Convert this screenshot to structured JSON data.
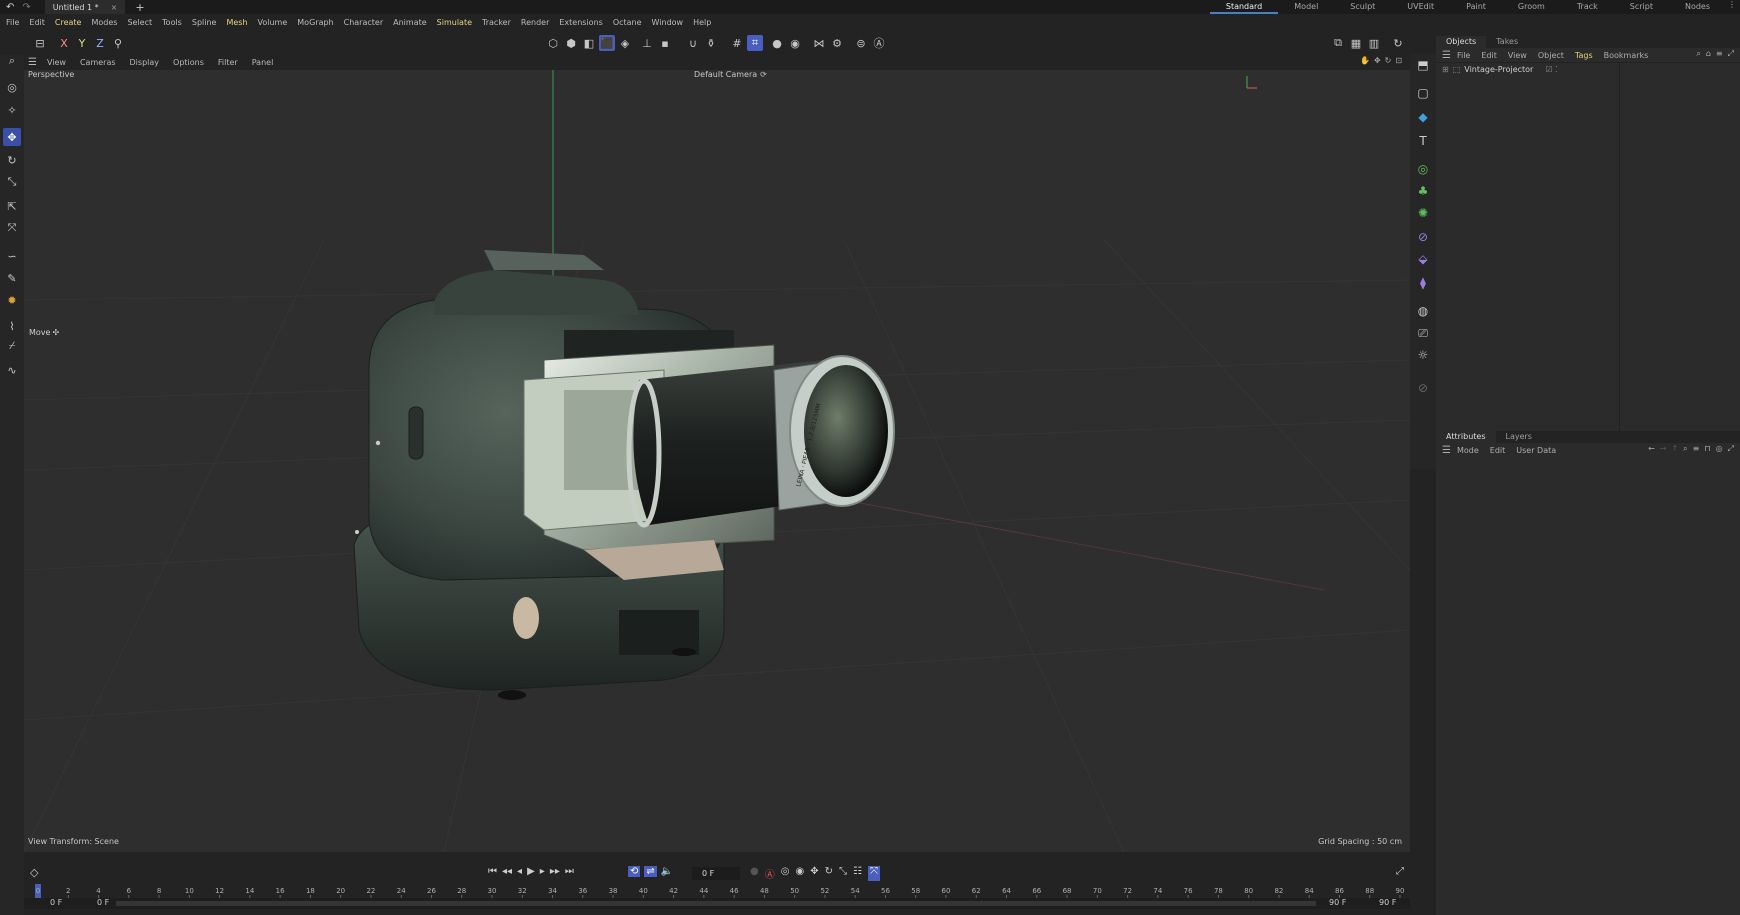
{
  "titlebar": {
    "tab_title": "Untitled 1 *",
    "close": "×",
    "add": "+",
    "workspaces": [
      "Standard",
      "Model",
      "Sculpt",
      "UVEdit",
      "Paint",
      "Groom",
      "Track",
      "Script",
      "Nodes"
    ],
    "active_workspace": "Standard"
  },
  "menubar": {
    "items": [
      "File",
      "Edit",
      "Create",
      "Modes",
      "Select",
      "Tools",
      "Spline",
      "Mesh",
      "Volume",
      "MoGraph",
      "Character",
      "Animate",
      "Simulate",
      "Tracker",
      "Render",
      "Extensions",
      "Octane",
      "Window",
      "Help"
    ],
    "highlighted": [
      "Create",
      "Mesh",
      "Simulate"
    ]
  },
  "toolbar": {
    "axis_x": "X",
    "axis_y": "Y",
    "axis_z": "Z"
  },
  "viewport_menu": {
    "items": [
      "View",
      "Cameras",
      "Display",
      "Options",
      "Filter",
      "Panel"
    ]
  },
  "viewport": {
    "view_name": "Perspective",
    "camera": "Default Camera",
    "camera_icon": "⟳",
    "tool_label": "Move",
    "tool_icon": "✣",
    "view_transform": "View Transform: Scene",
    "grid_spacing": "Grid Spacing : 50 cm",
    "lens_text": "LEINA · PIEAR · 1:2.8/125MM"
  },
  "objects_panel": {
    "tabs": [
      "Objects",
      "Takes"
    ],
    "menu": [
      "File",
      "Edit",
      "View",
      "Object",
      "Tags",
      "Bookmarks"
    ],
    "highlighted": "Tags",
    "objects": [
      {
        "name": "Vintage-Projector"
      }
    ]
  },
  "attributes_panel": {
    "tabs": [
      "Attributes",
      "Layers"
    ],
    "menu": [
      "Mode",
      "Edit",
      "User Data"
    ]
  },
  "timeline": {
    "current_frame": "0 F",
    "start_frame": "0 F",
    "min_frame": "0 F",
    "end_frame": "90 F",
    "max_frame": "90 F",
    "ticks": [
      "0",
      "2",
      "4",
      "6",
      "8",
      "10",
      "12",
      "14",
      "16",
      "18",
      "20",
      "22",
      "24",
      "26",
      "28",
      "30",
      "32",
      "34",
      "36",
      "38",
      "40",
      "42",
      "44",
      "46",
      "48",
      "50",
      "52",
      "54",
      "56",
      "58",
      "60",
      "62",
      "64",
      "66",
      "68",
      "70",
      "72",
      "74",
      "76",
      "78",
      "80",
      "82",
      "84",
      "86",
      "88",
      "90"
    ]
  },
  "colors": {
    "accent": "#4a5ec2",
    "highlight_text": "#e7d483",
    "viewport_bg": "#2e2e2e",
    "projector_body": "#3f4a44"
  }
}
